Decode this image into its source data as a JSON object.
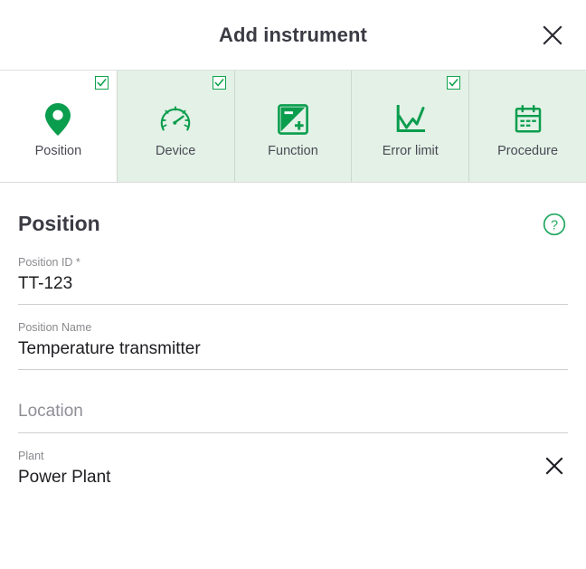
{
  "dialog": {
    "title": "Add instrument",
    "close_label": "close-icon"
  },
  "tabs": [
    {
      "id": "position",
      "label": "Position",
      "icon": "map-pin-icon",
      "checked": true,
      "active": true
    },
    {
      "id": "device",
      "label": "Device",
      "icon": "gauge-icon",
      "checked": true,
      "active": false
    },
    {
      "id": "function",
      "label": "Function",
      "icon": "function-icon",
      "checked": false,
      "active": false
    },
    {
      "id": "errorlimit",
      "label": "Error limit",
      "icon": "line-chart-icon",
      "checked": true,
      "active": false
    },
    {
      "id": "procedure",
      "label": "Procedure",
      "icon": "calendar-icon",
      "checked": false,
      "active": false
    }
  ],
  "section": {
    "title": "Position",
    "help_icon": "question-mark-circle-icon"
  },
  "fields": [
    {
      "label": "Position ID *",
      "value": "TT-123",
      "placeholder": ""
    },
    {
      "label": "Position Name",
      "value": "Temperature transmitter",
      "placeholder": ""
    },
    {
      "label": "",
      "value": "",
      "placeholder": "Location"
    },
    {
      "label": "Plant",
      "value": "Power Plant",
      "placeholder": ""
    }
  ],
  "colors": {
    "brand_green": "#12a450",
    "tab_inactive_bg": "#e3f1e6",
    "tab_active_bg": "#ffffff",
    "title_text": "#3b3b44",
    "label_text": "#8a8a8f",
    "value_text": "#1d1d21",
    "rule": "#cfcfcf"
  }
}
